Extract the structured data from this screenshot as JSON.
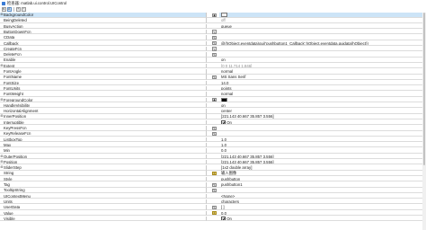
{
  "window": {
    "title": "检查器: matlab.ui.control.UIControl"
  },
  "toolbar": {
    "buttons": [
      {
        "name": "sort-category-icon",
        "glyph": "⇅"
      },
      {
        "name": "sort-alpha-icon",
        "glyph": "A"
      },
      {
        "name": "expand-all-icon",
        "glyph": "+"
      },
      {
        "name": "collapse-all-icon",
        "glyph": "−"
      }
    ]
  },
  "properties": [
    {
      "name": "BackgroundColor",
      "value": "",
      "expander": "⊞",
      "swatch": "#f0f0f0",
      "button": "color"
    },
    {
      "name": "BeingDeleted",
      "value": "off",
      "gray": true
    },
    {
      "name": "BusyAction",
      "value": "queue"
    },
    {
      "name": "ButtonDownFcn",
      "value": "",
      "button": "pencil"
    },
    {
      "name": "CData",
      "value": "",
      "button": "pencil"
    },
    {
      "name": "Callback",
      "value": "@(hObject,eventdata)gui('pushbutton1_Callback',hObject,eventdata,guidata(hObject))",
      "button": "pencil"
    },
    {
      "name": "CreateFcn",
      "value": "",
      "button": "pencil"
    },
    {
      "name": "DeleteFcn",
      "value": "",
      "button": "pencil"
    },
    {
      "name": "Enable",
      "value": "on"
    },
    {
      "name": "Extent",
      "value": "[0 0 11.714 1.846]",
      "gray": true,
      "expander": "⊞"
    },
    {
      "name": "FontAngle",
      "value": "normal"
    },
    {
      "name": "FontName",
      "value": "MS Sans Serif",
      "button": "pencil"
    },
    {
      "name": "FontSize",
      "value": "14.0"
    },
    {
      "name": "FontUnits",
      "value": "points"
    },
    {
      "name": "FontWeight",
      "value": "normal"
    },
    {
      "name": "ForegroundColor",
      "value": "",
      "expander": "⊞",
      "swatch": "#000000",
      "button": "color"
    },
    {
      "name": "HandleVisibility",
      "value": "on"
    },
    {
      "name": "HorizontalAlignment",
      "value": "center"
    },
    {
      "name": "InnerPosition",
      "value": "[221.143 40.667 35.857 3.556]",
      "expander": "⊞"
    },
    {
      "name": "Interruptible",
      "value": "On",
      "checkbox": true,
      "checked": true
    },
    {
      "name": "KeyPressFcn",
      "value": "",
      "button": "pencil"
    },
    {
      "name": "KeyReleaseFcn",
      "value": "",
      "button": "pencil"
    },
    {
      "name": "ListboxTop",
      "value": "1.0"
    },
    {
      "name": "Max",
      "value": "1.0"
    },
    {
      "name": "Min",
      "value": "0.0"
    },
    {
      "name": "OuterPosition",
      "value": "[221.143 40.667 35.857 3.556]",
      "expander": "⊞"
    },
    {
      "name": "Position",
      "value": "[221.143 40.667 35.857 3.556]",
      "expander": "⊞"
    },
    {
      "name": "SliderStep",
      "value": "[1x2 double array]",
      "expander": "⊞"
    },
    {
      "name": "String",
      "value": "输入图像",
      "button": "yellow"
    },
    {
      "name": "Style",
      "value": "pushbutton"
    },
    {
      "name": "Tag",
      "value": "pushbutton1",
      "button": "pencil"
    },
    {
      "name": "TooltipString",
      "value": "",
      "button": "pencil"
    },
    {
      "name": "UIContextMenu",
      "value": "<None>"
    },
    {
      "name": "Units",
      "value": "characters"
    },
    {
      "name": "UserData",
      "value": "[ ]",
      "button": "pencil"
    },
    {
      "name": "Value",
      "value": "0.0",
      "button": "yellow"
    },
    {
      "name": "Visible",
      "value": "On",
      "checkbox": true,
      "checked": true
    }
  ]
}
